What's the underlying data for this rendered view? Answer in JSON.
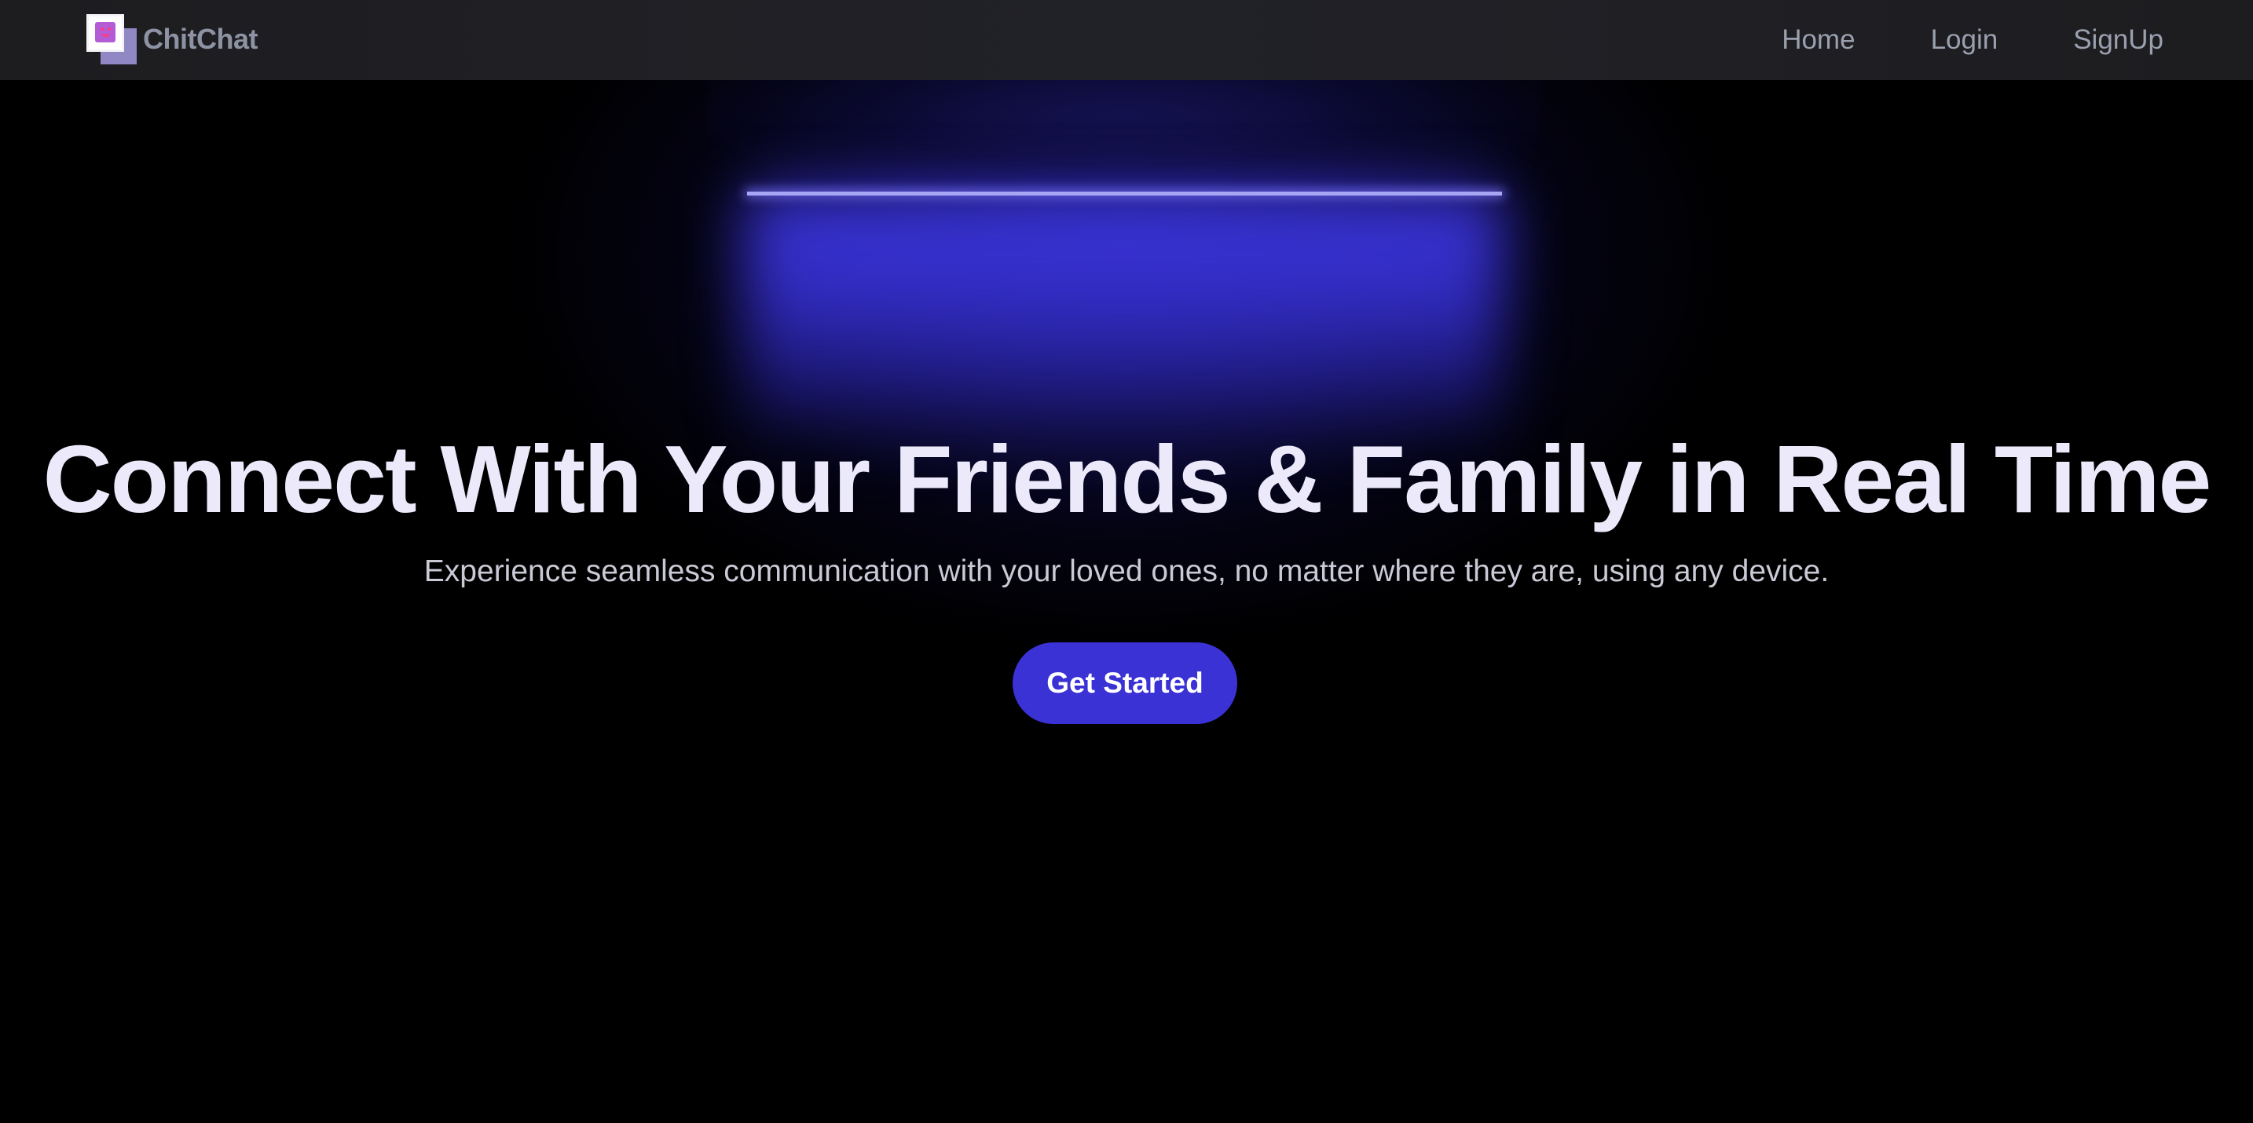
{
  "navbar": {
    "brand_name": "ChitChat",
    "links": [
      {
        "label": "Home"
      },
      {
        "label": "Login"
      },
      {
        "label": "SignUp"
      }
    ]
  },
  "hero": {
    "title": "Connect With Your Friends & Family in Real Time",
    "subtitle": "Experience seamless communication with your loved ones, no matter where they are, using any device.",
    "cta_label": "Get Started"
  },
  "colors": {
    "background": "#000000",
    "navbar_background": "#1f1f23",
    "accent": "#3a32d4",
    "glow_line": "#a7a6f5",
    "title_text": "#ece9fb",
    "nav_text": "#9aa0ae"
  },
  "icons": {
    "logo": "smiley-squares-logo-icon"
  }
}
